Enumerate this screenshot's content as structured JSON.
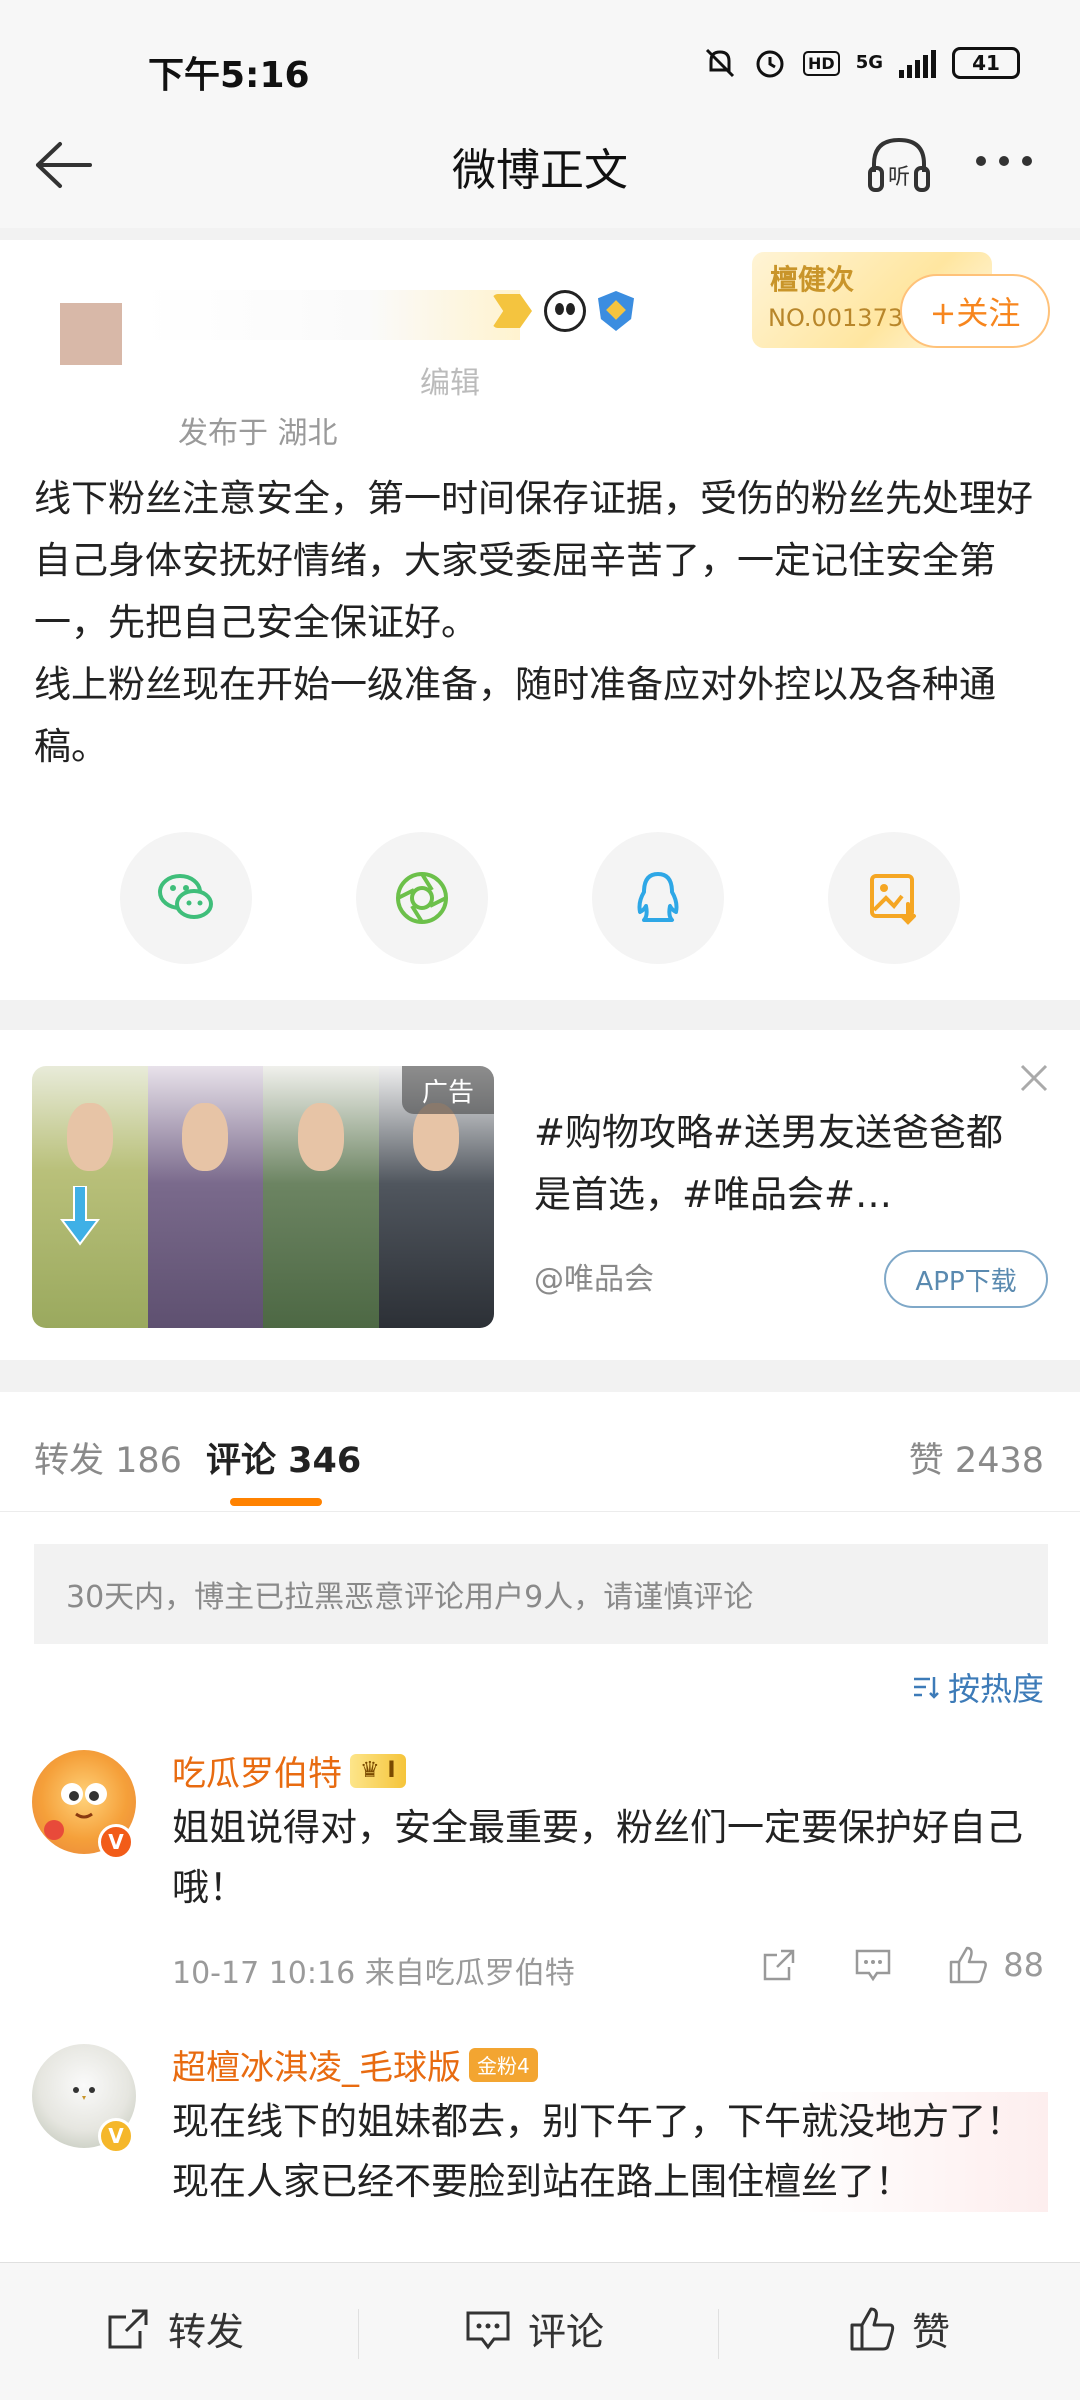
{
  "status_bar": {
    "time": "下午5:16",
    "network": "5G",
    "hd": "HD",
    "battery": "41"
  },
  "navbar": {
    "title": "微博正文",
    "listen_label": "听"
  },
  "post": {
    "author_subtitle": "编辑",
    "location": "发布于 湖北",
    "fan_card_name": "檀健次",
    "fan_card_number": "NO.001373",
    "follow_label": "+关注",
    "text_lines": [
      "线下粉丝注意安全，第一时间保存证据，受伤的粉丝先处理好自己身体安抚好情绪，大家受委屈辛苦了，一定记住安全第一，先把自己安全保证好。",
      "线上粉丝现在开始一级准备，随时准备应对外控以及各种通稿。"
    ],
    "share_icons": [
      "wechat-icon",
      "moments-icon",
      "qq-icon",
      "save-image-icon"
    ]
  },
  "ad": {
    "tag": "广告",
    "title": "#购物攻略#送男友送爸爸都是首选，#唯品会#…",
    "source": "@唯品会",
    "download_label": "APP下载"
  },
  "tabs": {
    "repost": "转发 186",
    "comment": "评论 346",
    "like": "赞 2438"
  },
  "comments": {
    "notice": "30天内，博主已拉黑恶意评论用户9人，请谨慎评论",
    "sort_label": "按热度",
    "items": [
      {
        "name": "吃瓜罗伯特",
        "badge": "I",
        "text": "姐姐说得对，安全最重要，粉丝们一定要保护好自己哦！",
        "meta": "10-17 10:16  来自吃瓜罗伯特",
        "likes": "88"
      },
      {
        "name": "超檀冰淇凌_毛球版",
        "badge": "金粉4",
        "text": "现在线下的姐妹都去，别下午了，下午就没地方了！现在人家已经不要脸到站在路上围住檀丝了！"
      }
    ]
  },
  "bottom_bar": {
    "repost": "转发",
    "comment": "评论",
    "like": "赞"
  },
  "colors": {
    "accent_orange": "#ff8200",
    "link_blue": "#3d7bb8",
    "username_orange": "#e86b10"
  }
}
